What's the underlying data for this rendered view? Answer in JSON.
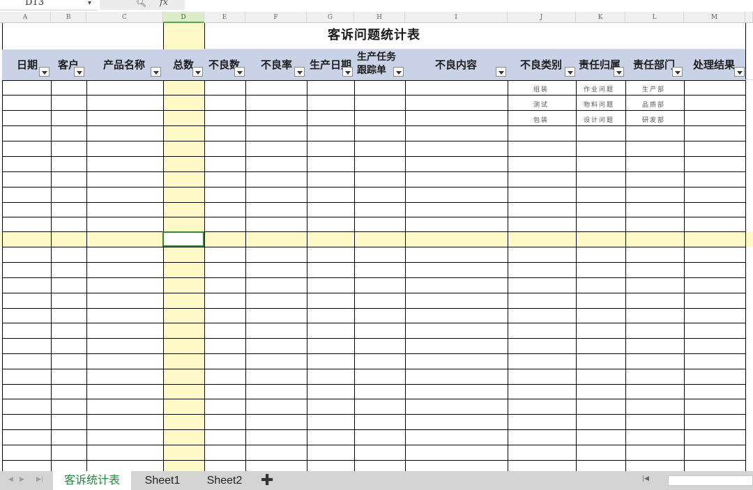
{
  "namebox": {
    "cell": "D13"
  },
  "formula_bar": {
    "zoom_icon": "magnifier-icon",
    "fx_label": "fx"
  },
  "columns": [
    "A",
    "B",
    "C",
    "D",
    "E",
    "F",
    "G",
    "H",
    "I",
    "J",
    "K",
    "L",
    "M"
  ],
  "title": "客诉问题统计表",
  "headers": [
    {
      "col": "A",
      "label": "日期"
    },
    {
      "col": "B",
      "label": "客户"
    },
    {
      "col": "C",
      "label": "产品名称"
    },
    {
      "col": "D",
      "label": "总数"
    },
    {
      "col": "E",
      "label": "不良数"
    },
    {
      "col": "F",
      "label": "不良率"
    },
    {
      "col": "G",
      "label": "生产日期"
    },
    {
      "col": "H",
      "label": "生产任务跟踪单"
    },
    {
      "col": "I",
      "label": "不良内容"
    },
    {
      "col": "J",
      "label": "不良类别"
    },
    {
      "col": "K",
      "label": "责任归属"
    },
    {
      "col": "L",
      "label": "责任部门"
    },
    {
      "col": "M",
      "label": "处理结果"
    }
  ],
  "lists": {
    "defect_category": [
      "组装",
      "测试",
      "包装"
    ],
    "responsibility": [
      "作业问题",
      "物料问题",
      "设计问题"
    ],
    "department": [
      "生产部",
      "品质部",
      "研发部"
    ]
  },
  "sheet_tabs": [
    {
      "label": "客诉统计表",
      "active": true
    },
    {
      "label": "Sheet1",
      "active": false
    },
    {
      "label": "Sheet2",
      "active": false
    }
  ],
  "colors": {
    "header_bg": "#c9d2e6",
    "selection_bg": "#fff9c8",
    "active_tab": "#1e8a3a"
  }
}
